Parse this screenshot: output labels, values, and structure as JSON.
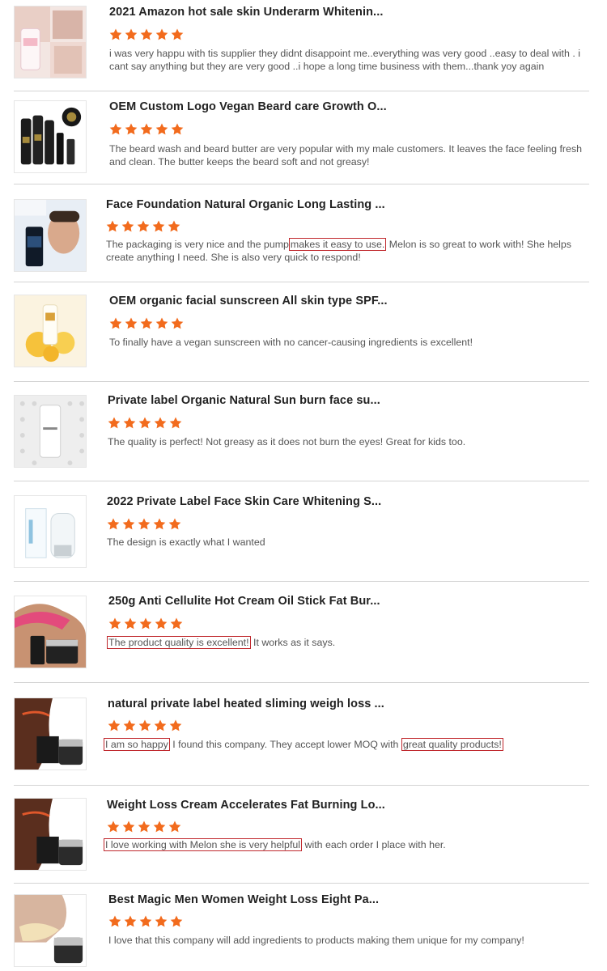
{
  "colors": {
    "star": "#f26b1d",
    "highlight_border": "#c0282d"
  },
  "rating_stars": 5,
  "reviews": [
    {
      "title": "2021 Amazon hot sale skin Underarm Whitenin...",
      "image": "underarm-whitening-cream-product-image",
      "comment": "i  was  very   happu with tis supplier   they didnt   disappoint   me..everything  was very good ..easy to deal with . i cant say  anything  but they  are very  good  ..i hope  a long time  business   with them...thank yoy again"
    },
    {
      "title": "OEM Custom Logo Vegan Beard care Growth O...",
      "image": "beard-care-kit-product-image",
      "comment": "The beard wash and beard butter are very popular with my male customers. It leaves the face feeling fresh and clean. The butter keeps the beard soft and not greasy!"
    },
    {
      "title": "Face Foundation Natural Organic Long Lasting ...",
      "image": "mens-face-foundation-product-image",
      "comment_parts": [
        "The packaging is very nice and the pump",
        "makes it easy to use.",
        " Melon is so great to work with! She helps create anything I need. She is also very quick to respond!"
      ]
    },
    {
      "title": "OEM organic facial sunscreen All skin type SPF...",
      "image": "facial-sunscreen-product-image",
      "comment": "To finally have a vegan sunscreen with no cancer-causing ingredients is excellent!"
    },
    {
      "title": "Private label Organic Natural Sun burn face su...",
      "image": "sunburn-face-cream-product-image",
      "comment": "The quality is perfect! Not greasy as it does not burn the eyes! Great for kids too."
    },
    {
      "title": "2022 Private Label Face Skin Care Whitening S...",
      "image": "whitening-skin-care-product-image",
      "comment": "The design is exactly what I wanted"
    },
    {
      "title": "250g Anti Cellulite Hot Cream Oil Stick Fat Bur...",
      "image": "anti-cellulite-cream-product-image",
      "comment_parts": [
        "The product quality is excellent!",
        " It works as it says."
      ]
    },
    {
      "title": "natural private label heated sliming weigh loss ...",
      "image": "slimming-cream-product-image",
      "comment_parts": [
        "I am so happy",
        " I found this company. They accept lower MOQ with ",
        "great quality products!"
      ]
    },
    {
      "title": "Weight Loss Cream Accelerates Fat Burning Lo...",
      "image": "weight-loss-cream-product-image",
      "comment_parts": [
        "I love working with Melon she is very helpful",
        " with each order I place with her."
      ]
    },
    {
      "title": "Best Magic Men Women Weight Loss Eight Pa...",
      "image": "eight-pack-weight-loss-product-image",
      "comment": "I love that this company will add ingredients to products making them unique for my company!"
    }
  ]
}
